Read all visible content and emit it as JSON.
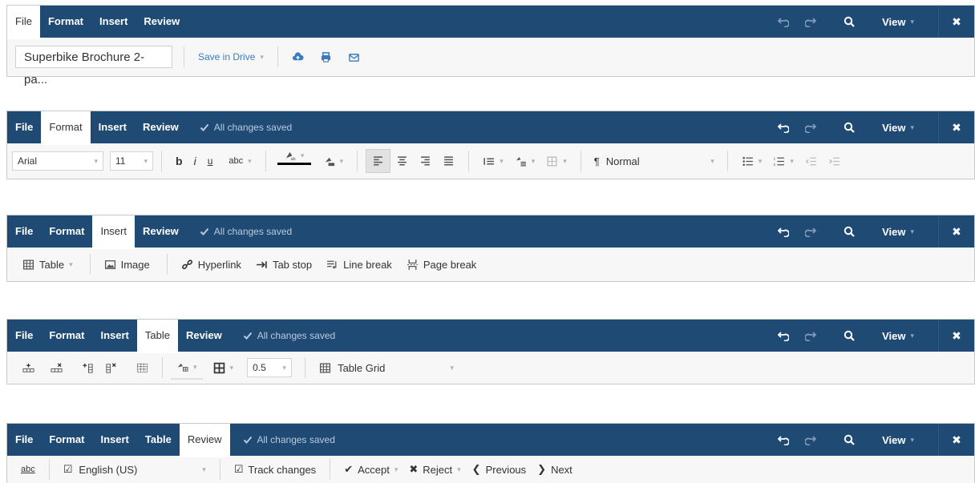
{
  "colors": {
    "tabbar": "#1f4a73",
    "accent_icon": "#3a7cc0",
    "saved_text": "#b8cbe0"
  },
  "right_controls": {
    "view_label": "View"
  },
  "ribbon_file": {
    "tabs": [
      "File",
      "Format",
      "Insert",
      "Review"
    ],
    "doc_name": "Superbike Brochure 2-pa...",
    "save_label": "Save in Drive"
  },
  "ribbon_format": {
    "tabs": [
      "File",
      "Format",
      "Insert",
      "Review"
    ],
    "status": "All changes saved",
    "font": "Arial",
    "size": "11",
    "spell_label": "abc",
    "style": "Normal"
  },
  "ribbon_insert": {
    "tabs": [
      "File",
      "Format",
      "Insert",
      "Review"
    ],
    "status": "All changes saved",
    "items": {
      "table": "Table",
      "image": "Image",
      "hyperlink": "Hyperlink",
      "tabstop": "Tab stop",
      "linebreak": "Line break",
      "pagebreak": "Page break"
    }
  },
  "ribbon_table": {
    "tabs": [
      "File",
      "Format",
      "Insert",
      "Table",
      "Review"
    ],
    "status": "All changes saved",
    "border_width": "0.5",
    "table_style": "Table Grid"
  },
  "ribbon_review": {
    "tabs": [
      "File",
      "Format",
      "Insert",
      "Table",
      "Review"
    ],
    "status": "All changes saved",
    "spell_label": "abc",
    "language": "English (US)",
    "track": "Track changes",
    "accept": "Accept",
    "reject": "Reject",
    "previous": "Previous",
    "next": "Next"
  }
}
